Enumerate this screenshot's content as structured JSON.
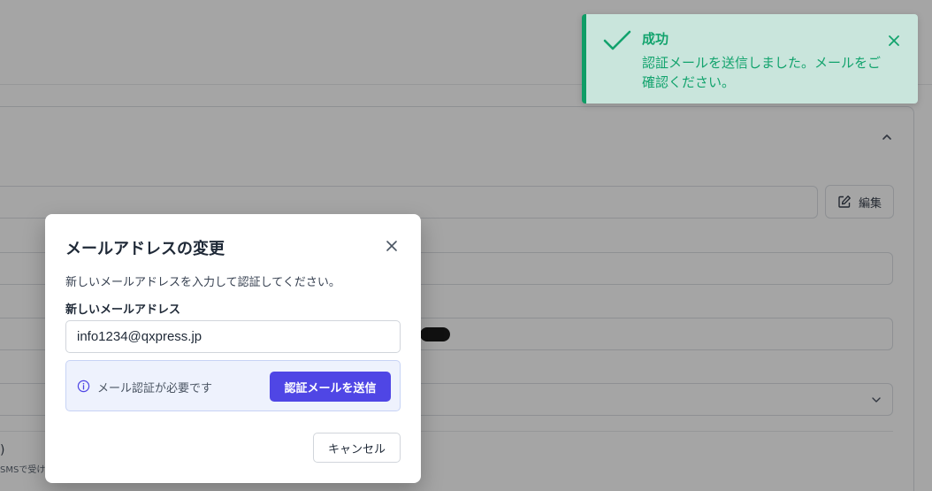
{
  "background": {
    "edit_button_label": "編集",
    "fragment_paren": ")",
    "fragment_sms": "SMSで受け"
  },
  "toast": {
    "title": "成功",
    "message": "認証メールを送信しました。メールをご確認ください。",
    "accent_color": "#0f9d66",
    "icons": [
      "checkmark-icon",
      "close-icon"
    ]
  },
  "modal": {
    "title": "メールアドレスの変更",
    "description": "新しいメールアドレスを入力して認証してください。",
    "email_label": "新しいメールアドレス",
    "email_value": "info1234@qxpress.jp",
    "verification_notice": "メール認証が必要です",
    "send_button_label": "認証メールを送信",
    "cancel_button_label": "キャンセル",
    "primary_color": "#4f46e5",
    "icons": [
      "close-icon",
      "info-icon"
    ]
  }
}
